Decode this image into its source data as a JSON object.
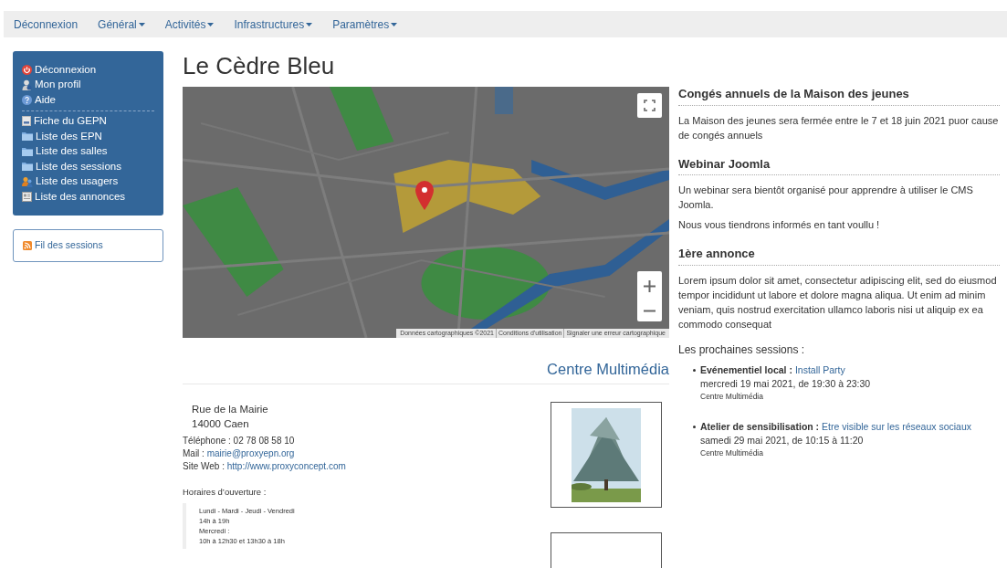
{
  "navbar": {
    "items": [
      {
        "label": "Déconnexion",
        "dropdown": false
      },
      {
        "label": "Général",
        "dropdown": true
      },
      {
        "label": "Activités",
        "dropdown": true
      },
      {
        "label": "Infrastructures",
        "dropdown": true
      },
      {
        "label": "Paramètres",
        "dropdown": true
      }
    ]
  },
  "sidebar": {
    "groups": [
      [
        {
          "label": "Déconnexion",
          "kind": "power"
        },
        {
          "label": "Mon profil",
          "kind": "user"
        },
        {
          "label": "Aide",
          "kind": "help"
        }
      ],
      [
        {
          "label": "Fiche du GEPN",
          "kind": "doc"
        },
        {
          "label": "Liste des EPN",
          "kind": "folder"
        },
        {
          "label": "Liste des salles",
          "kind": "folder"
        },
        {
          "label": "Liste des sessions",
          "kind": "folder"
        },
        {
          "label": "Liste des usagers",
          "kind": "users"
        },
        {
          "label": "Liste des annonces",
          "kind": "news"
        }
      ]
    ],
    "feed_link": "Fil des sessions"
  },
  "page_title": "Le Cèdre Bleu",
  "map": {
    "attribution": [
      "Données cartographiques ©2021",
      "Conditions d'utilisation",
      "Signaler une erreur cartographique"
    ]
  },
  "venue": {
    "name": "Centre Multimédia",
    "address": [
      "Rue de la Mairie",
      "14000 Caen"
    ],
    "contacts": [
      {
        "label": "Téléphone : ",
        "value": "02 78 08 58 10",
        "link": false
      },
      {
        "label": "Mail : ",
        "value": "mairie@proxyepn.org",
        "link": true
      },
      {
        "label": "Site Web : ",
        "value": "http://www.proxyconcept.com",
        "link": true
      }
    ],
    "hours_title": "Horaires d’ouverture :",
    "hours": [
      "Lundi - Mardi - Jeudi - Vendredi",
      "14h à 19h",
      "Mercredi :",
      "10h à 12h30 et 13h30 à 18h"
    ],
    "photos": [
      {
        "kind": "picture"
      },
      {
        "kind": "empty"
      }
    ]
  },
  "announcements": [
    {
      "title": "Congés annuels de la Maison des jeunes",
      "paragraphs": [
        "La Maison des jeunes sera fermée entre le 7 et 18 juin 2021 puor cause de congés annuels"
      ]
    },
    {
      "title": "Webinar Joomla",
      "paragraphs": [
        "Un webinar sera bientôt organisé pour apprendre à utiliser le CMS Joomla.",
        "Nous vous tiendrons informés en tant voullu !"
      ]
    },
    {
      "title": "1ère annonce",
      "paragraphs": [
        "Lorem ipsum dolor sit amet, consectetur adipiscing elit, sed do eiusmod tempor incididunt ut labore et dolore magna aliqua. Ut enim ad minim veniam, quis nostrud exercitation ullamco laboris nisi ut aliquip ex ea commodo consequat"
      ]
    }
  ],
  "sessions": {
    "title": "Les prochaines sessions :",
    "items": [
      {
        "category": "Evénementiel local :",
        "name": "Install Party",
        "date": "mercredi 19 mai 2021, de 19:30 à 23:30",
        "place": "Centre Multimédia"
      },
      {
        "category": "Atelier de sensibilisation :",
        "name": "Etre visible sur les réseaux sociaux",
        "date": "samedi 29 mai 2021, de 10:15 à 11:20",
        "place": "Centre Multimédia"
      }
    ]
  }
}
